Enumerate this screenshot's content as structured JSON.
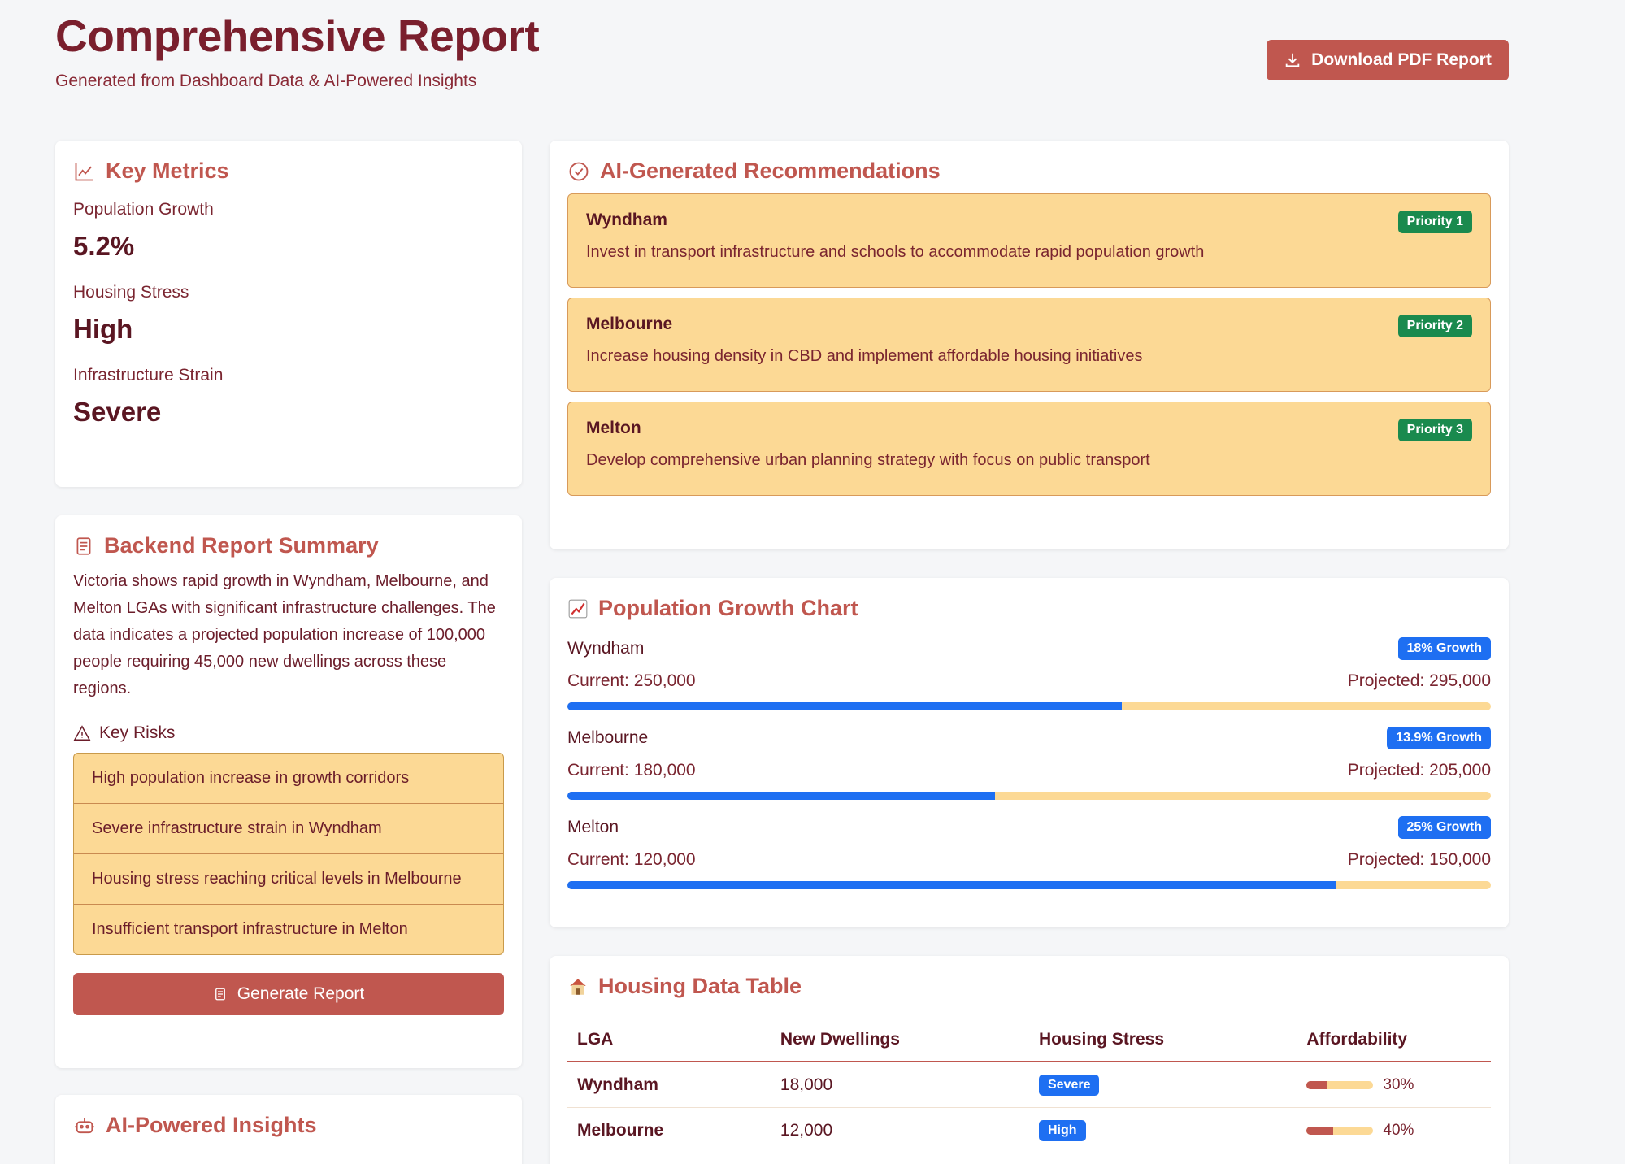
{
  "header": {
    "title": "Comprehensive Report",
    "subtitle": "Generated from Dashboard Data & AI-Powered Insights",
    "download_label": "Download PDF Report"
  },
  "metrics": {
    "title": "Key Metrics",
    "items": [
      {
        "label": "Population Growth",
        "value": "5.2%"
      },
      {
        "label": "Housing Stress",
        "value": "High"
      },
      {
        "label": "Infrastructure Strain",
        "value": "Severe"
      }
    ]
  },
  "summary": {
    "title": "Backend Report Summary",
    "text": "Victoria shows rapid growth in Wyndham, Melbourne, and Melton LGAs with significant infrastructure challenges. The data indicates a projected population increase of 100,000 people requiring 45,000 new dwellings across these regions.",
    "risks_heading": "Key Risks",
    "risks": [
      "High population increase in growth corridors",
      "Severe infrastructure strain in Wyndham",
      "Housing stress reaching critical levels in Melbourne",
      "Insufficient transport infrastructure in Melton"
    ],
    "generate_label": "Generate Report"
  },
  "insights": {
    "title": "AI-Powered Insights"
  },
  "recommendations": {
    "title": "AI-Generated Recommendations",
    "items": [
      {
        "lga": "Wyndham",
        "priority": "Priority 1",
        "text": "Invest in transport infrastructure and schools to accommodate rapid population growth"
      },
      {
        "lga": "Melbourne",
        "priority": "Priority 2",
        "text": "Increase housing density in CBD and implement affordable housing initiatives"
      },
      {
        "lga": "Melton",
        "priority": "Priority 3",
        "text": "Develop comprehensive urban planning strategy with focus on public transport"
      }
    ]
  },
  "growth_chart": {
    "title": "Population Growth Chart",
    "icon": "chart-emoji",
    "rows": [
      {
        "lga": "Wyndham",
        "growth": "18% Growth",
        "current": "Current: 250,000",
        "projected": "Projected: 295,000",
        "fill": 0.6
      },
      {
        "lga": "Melbourne",
        "growth": "13.9% Growth",
        "current": "Current: 180,000",
        "projected": "Projected: 205,000",
        "fill": 0.463
      },
      {
        "lga": "Melton",
        "growth": "25% Growth",
        "current": "Current: 120,000",
        "projected": "Projected: 150,000",
        "fill": 0.833
      }
    ]
  },
  "housing_table": {
    "title": "Housing Data Table",
    "icon": "house-emoji",
    "columns": [
      "LGA",
      "New Dwellings",
      "Housing Stress",
      "Affordability"
    ],
    "rows": [
      {
        "lga": "Wyndham",
        "dwellings": "18,000",
        "stress": "Severe",
        "afford": "30%",
        "afford_value": 0.3
      },
      {
        "lga": "Melbourne",
        "dwellings": "12,000",
        "stress": "High",
        "afford": "40%",
        "afford_value": 0.4
      }
    ]
  },
  "colors": {
    "accent": "#c0574f",
    "title": "#7a1f2d",
    "blue": "#1e6ff2",
    "green": "#1a8a4e",
    "highlight": "#fcd995"
  }
}
